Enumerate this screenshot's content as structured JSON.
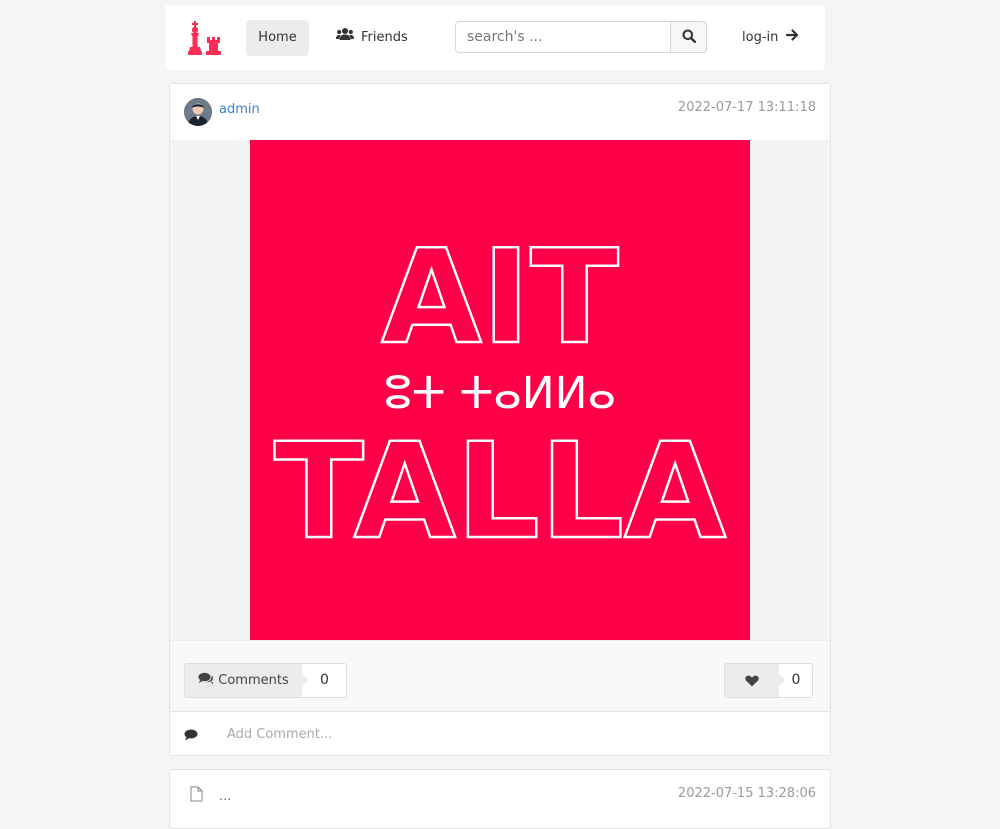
{
  "colors": {
    "brand": "#ff0048",
    "link": "#3a84c4",
    "date": "#9a9a9a"
  },
  "nav": {
    "logo_icon": "chess-king-rook-icon",
    "home_label": "Home",
    "friends_label": "Friends",
    "friends_icon": "users-icon",
    "search_placeholder": "search's ...",
    "search_icon": "search-icon",
    "login_label": "log-in",
    "login_icon": "arrow-right-icon"
  },
  "posts": [
    {
      "author": "admin",
      "date": "2022-07-17 13:11:18",
      "image": {
        "bg": "#ff0048",
        "line1": "AIT",
        "tifinagh": "ⵓⵜ ⵜⴰⵍⵍⴰ",
        "line2": "TALLA"
      },
      "comments_label": "Comments",
      "comments_count": "0",
      "likes_count": "0",
      "comment_placeholder": "Add Comment..."
    },
    {
      "author": "...",
      "date": "2022-07-15 13:28:06"
    }
  ]
}
